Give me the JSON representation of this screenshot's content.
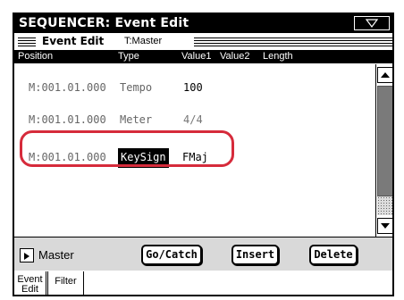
{
  "window": {
    "title": "SEQUENCER: Event Edit",
    "menu_icon": "triangle-down-icon"
  },
  "section": {
    "label": "Event Edit",
    "track": "T:Master"
  },
  "columns": {
    "position": "Position",
    "type": "Type",
    "value1": "Value1",
    "value2": "Value2",
    "length": "Length"
  },
  "events": [
    {
      "position": "M:001.01.000",
      "type": "Tempo",
      "value1": "100",
      "selected": false
    },
    {
      "position": "M:001.01.000",
      "type": "Meter",
      "value1": "4/4",
      "selected": false
    },
    {
      "position": "M:001.01.000",
      "type": "KeySign",
      "value1": "FMaj",
      "selected": true
    }
  ],
  "colors": {
    "highlight": "#d62b3b",
    "selection_bg": "#000000",
    "bottombar_bg": "#d9d9d9"
  },
  "bottombar": {
    "master_label": "Master",
    "gocatch_label": "Go/Catch",
    "insert_label": "Insert",
    "delete_label": "Delete"
  },
  "tabs": {
    "event_edit_line1": "Event",
    "event_edit_line2": "Edit",
    "filter": "Filter"
  }
}
